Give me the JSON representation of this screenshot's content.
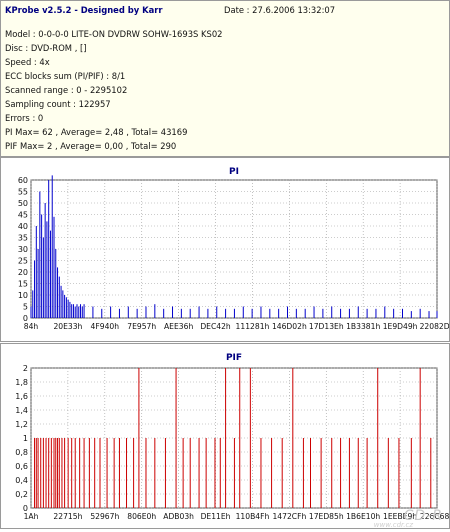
{
  "info": {
    "title": "KProbe v2.5.2 - Designed by Karr",
    "date": "Date : 27.6.2006 13:32:07",
    "lines": [
      "Model : 0-0-0-0 LITE-ON DVDRW SOHW-1693S KS02",
      "Disc : DVD-ROM , []",
      "Speed : 4x",
      "ECC blocks sum (PI/PIF) : 8/1",
      "Scanned range : 0 - 2295102",
      "Sampling count : 122957",
      "Errors : 0",
      "PI Max= 62 , Average= 2,48 , Total= 43169",
      "PIF Max= 2 , Average= 0,00 , Total= 290"
    ]
  },
  "watermark": "CD-R",
  "watermark_url": "www.cdr.cz",
  "chart_data": [
    {
      "type": "bar",
      "title": "PI",
      "color": "#0000cc",
      "ylim": [
        0,
        60
      ],
      "yticks": [
        0,
        5,
        10,
        15,
        20,
        25,
        30,
        35,
        40,
        45,
        50,
        55,
        60
      ],
      "xlim": [
        0,
        2295102
      ],
      "xtick_labels": [
        "84h",
        "20E33h",
        "4F940h",
        "7E957h",
        "AEE36h",
        "DEC42h",
        "111281h",
        "146D02h",
        "17D13Eh",
        "1B3381h",
        "1E9D49h",
        "22082Dh"
      ],
      "grid": true,
      "series": [
        {
          "x": [
            0,
            10000,
            20000,
            30000,
            40000,
            50000,
            60000,
            70000,
            80000,
            90000,
            100000,
            110000,
            120000,
            130000,
            140000,
            150000,
            160000,
            170000,
            180000,
            190000,
            200000,
            210000,
            220000,
            230000,
            240000,
            250000,
            260000,
            270000,
            280000,
            290000,
            300000,
            350000,
            400000,
            450000,
            500000,
            550000,
            600000,
            650000,
            700000,
            750000,
            800000,
            850000,
            900000,
            950000,
            1000000,
            1050000,
            1100000,
            1150000,
            1200000,
            1250000,
            1300000,
            1350000,
            1400000,
            1450000,
            1500000,
            1550000,
            1600000,
            1650000,
            1700000,
            1750000,
            1800000,
            1850000,
            1900000,
            1950000,
            2000000,
            2050000,
            2100000,
            2150000,
            2200000,
            2250000,
            2295102
          ],
          "values": [
            5,
            12,
            25,
            40,
            30,
            55,
            45,
            35,
            50,
            42,
            60,
            38,
            62,
            44,
            30,
            22,
            18,
            14,
            12,
            10,
            9,
            8,
            7,
            6,
            6,
            5,
            6,
            5,
            6,
            5,
            6,
            5,
            4,
            5,
            4,
            5,
            4,
            5,
            6,
            4,
            5,
            4,
            4,
            5,
            4,
            5,
            4,
            4,
            5,
            4,
            5,
            4,
            4,
            5,
            4,
            4,
            5,
            4,
            5,
            4,
            4,
            5,
            4,
            4,
            5,
            4,
            4,
            3,
            4,
            3,
            3
          ]
        }
      ]
    },
    {
      "type": "bar",
      "title": "PIF",
      "color": "#cc0000",
      "ylim": [
        0,
        2
      ],
      "yticks": [
        0,
        0.2,
        0.4,
        0.6,
        0.8,
        1,
        1.2,
        1.4,
        1.6,
        1.8,
        2
      ],
      "ytick_labels": [
        "0",
        "0,2",
        "0,4",
        "0,6",
        "0,8",
        "1",
        "1,2",
        "1,4",
        "1,6",
        "1,8",
        "2"
      ],
      "xlim": [
        0,
        2295102
      ],
      "xtick_labels": [
        "1Ah",
        "22715h",
        "52967h",
        "806E0h",
        "ADB03h",
        "DE11Eh",
        "110B4Fh",
        "1472CFh",
        "17ED85h",
        "1B6E10h",
        "1EEBE9h",
        "226C68h"
      ],
      "grid": true,
      "series": [
        {
          "x": [
            20000,
            30000,
            40000,
            55000,
            70000,
            85000,
            100000,
            115000,
            130000,
            140000,
            150000,
            160000,
            175000,
            190000,
            210000,
            230000,
            250000,
            275000,
            300000,
            330000,
            360000,
            390000,
            430000,
            470000,
            500000,
            540000,
            580000,
            610000,
            650000,
            700000,
            760000,
            820000,
            860000,
            900000,
            950000,
            990000,
            1040000,
            1070000,
            1100000,
            1150000,
            1180000,
            1240000,
            1300000,
            1360000,
            1420000,
            1480000,
            1540000,
            1580000,
            1640000,
            1700000,
            1750000,
            1800000,
            1850000,
            1900000,
            1960000,
            2020000,
            2080000,
            2150000,
            2200000,
            2260000
          ],
          "values": [
            1,
            1,
            1,
            1,
            1,
            1,
            1,
            1,
            1,
            1,
            1,
            1,
            1,
            1,
            1,
            1,
            1,
            1,
            1,
            1,
            1,
            1,
            1,
            1,
            1,
            1,
            1,
            2,
            1,
            1,
            1,
            2,
            1,
            1,
            1,
            1,
            1,
            1,
            2,
            1,
            2,
            2,
            1,
            1,
            1,
            2,
            1,
            1,
            1,
            1,
            1,
            1,
            1,
            1,
            2,
            1,
            1,
            1,
            2,
            1
          ]
        }
      ]
    }
  ]
}
